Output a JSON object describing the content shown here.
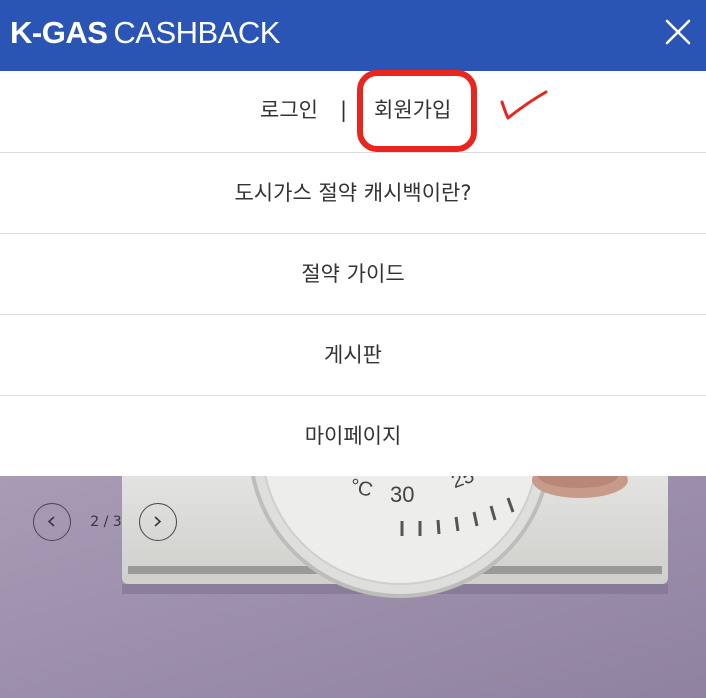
{
  "header": {
    "logo_bold": "K-GAS",
    "logo_light": "CASHBACK",
    "close_icon": "close-icon",
    "background": "#2b55b5"
  },
  "menu": {
    "login": "로그인",
    "separator": "|",
    "join": "회원가입",
    "items": [
      {
        "label": "도시가스 절약 캐시백이란?"
      },
      {
        "label": "절약 가이드"
      },
      {
        "label": "게시판"
      },
      {
        "label": "마이페이지"
      }
    ]
  },
  "annotation": {
    "highlight_color": "#e8251f"
  },
  "slider": {
    "prev_icon": "chevron-left-icon",
    "next_icon": "chevron-right-icon",
    "counter": "2 / 3"
  },
  "hero": {
    "dial_labels": [
      "30",
      "°C",
      "25"
    ]
  }
}
